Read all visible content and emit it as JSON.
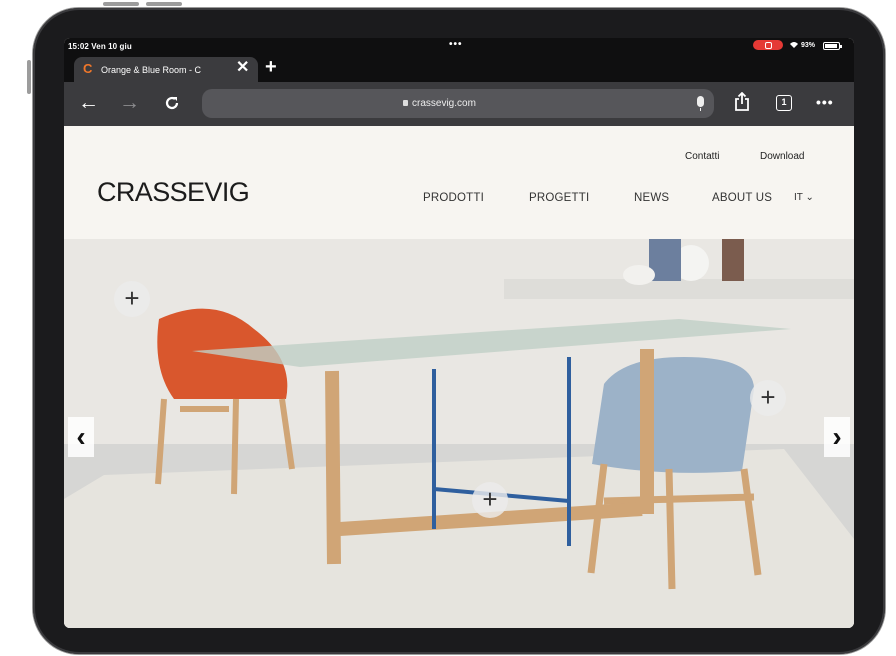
{
  "status_bar": {
    "time": "15:02  Ven 10 giu",
    "multitask_dots": "•••",
    "wifi": "wifi-icon",
    "battery_percent": "93%",
    "battery_level": 0.93
  },
  "browser": {
    "tab": {
      "favicon": "C",
      "title": "Orange & Blue Room - C",
      "close_symbol": "✕"
    },
    "new_tab_symbol": "+",
    "url": "crassevig.com",
    "icons": {
      "back": "←",
      "forward": "→",
      "reload": "reload-icon",
      "share": "share-icon",
      "tabs_count": "1",
      "more": "•••"
    }
  },
  "site": {
    "top_links": [
      "Contatti",
      "Download"
    ],
    "logo": "CRASSEVIG",
    "nav": [
      "PRODOTTI",
      "PROGETTI",
      "NEWS",
      "ABOUT US"
    ],
    "language": "IT",
    "language_chevron": "⌄"
  },
  "hero": {
    "hotspot_symbol": "+",
    "prev_symbol": "‹",
    "next_symbol": "›",
    "colors": {
      "wall": "#e9e7e3",
      "floor": "#d6d6d4",
      "rug": "#e6e4de",
      "orange_chair": "#d9572d",
      "blue_chair": "#9cb2c8",
      "wood": "#d0a576",
      "table_frame": "#2f5f9e",
      "glass": "#bfd0c6"
    }
  }
}
